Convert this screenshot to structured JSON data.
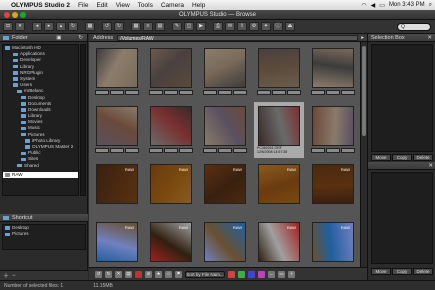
{
  "menubar": {
    "app": "OLYMPUS Studio 2",
    "items": [
      "File",
      "Edit",
      "View",
      "Tools",
      "Camera",
      "Help"
    ],
    "clock": "Mon 3:43 PM"
  },
  "window": {
    "title": "OLYMPUS Studio — Browse"
  },
  "toolbar": {
    "search_placeholder": "Q"
  },
  "left": {
    "folder_tab": "Folder",
    "tree": [
      "Macintosh HD",
      "Applications",
      "Developer",
      "Library",
      "NRGPlugin",
      "System",
      "Users",
      "mrBelanc",
      "Desktop",
      "Documents",
      "Downloads",
      "Library",
      "Movies",
      "Music",
      "Pictures",
      "iPhoto Library",
      "OLYMPUS Master 2",
      "Public",
      "Sites",
      "Shared",
      "RAW"
    ],
    "selected_index": 20,
    "shortcuts_title": "Shortcut",
    "shortcuts": [
      "Desktop",
      "Pictures"
    ]
  },
  "center": {
    "address_label": "Address",
    "address_path": "/Volumes/RAW",
    "sort_label": "Sort by File Nam...",
    "selected_caption": [
      "PC060261.ORF",
      "12/6/2008 14:57:38"
    ],
    "raw_tag": "RAW"
  },
  "right": {
    "title1": "Selection Box",
    "buttons": [
      "Move",
      "Copy",
      "Delete"
    ]
  },
  "status": {
    "selected_files": "Number of selected files: 1",
    "size": "11.15MB"
  }
}
